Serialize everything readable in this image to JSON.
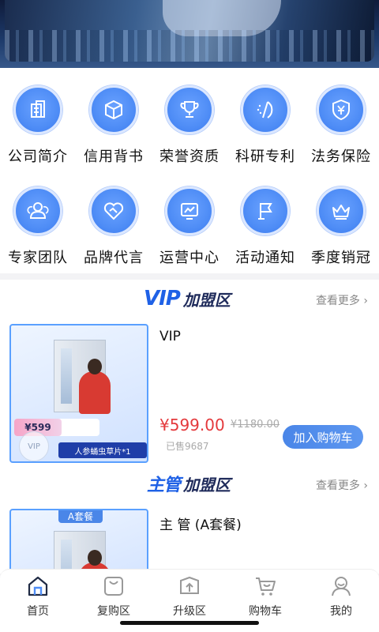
{
  "grid": {
    "row1": [
      {
        "label": "公司简介",
        "icon": "building-icon"
      },
      {
        "label": "信用背书",
        "icon": "cube-icon"
      },
      {
        "label": "荣誉资质",
        "icon": "trophy-icon"
      },
      {
        "label": "科研专利",
        "icon": "sparkle-stick-icon"
      },
      {
        "label": "法务保险",
        "icon": "yen-shield-icon"
      }
    ],
    "row2": [
      {
        "label": "专家团队",
        "icon": "team-icon"
      },
      {
        "label": "品牌代言",
        "icon": "heart-handshake-icon"
      },
      {
        "label": "运营中心",
        "icon": "monitor-chart-icon"
      },
      {
        "label": "活动通知",
        "icon": "flag-icon"
      },
      {
        "label": "季度销冠",
        "icon": "crown-icon"
      }
    ]
  },
  "vip_section": {
    "title_em": "VIP",
    "title_cn": "加盟区",
    "more": "查看更多",
    "product": {
      "name": "VIP",
      "price": "¥599.00",
      "old_price": "¥1180.00",
      "sold": "已售9687",
      "add_cart": "加入购物车",
      "thumb_price": "¥599",
      "thumb_ribbon": "人参蛹虫草片*1",
      "thumb_stamp": "VIP"
    }
  },
  "director_section": {
    "title_em": "主管",
    "title_cn": "加盟区",
    "more": "查看更多",
    "product": {
      "name": "主 管 (A套餐)",
      "thumb_tag": "A套餐"
    }
  },
  "tabbar": [
    {
      "label": "首页",
      "icon": "home-icon",
      "active": true
    },
    {
      "label": "复购区",
      "icon": "bag-icon",
      "active": false
    },
    {
      "label": "升级区",
      "icon": "upgrade-box-icon",
      "active": false
    },
    {
      "label": "购物车",
      "icon": "cart-icon",
      "active": false
    },
    {
      "label": "我的",
      "icon": "user-icon",
      "active": false
    }
  ],
  "colors": {
    "accent": "#4f8df6",
    "price": "#e4393c",
    "title_blue": "#1f61e6"
  }
}
